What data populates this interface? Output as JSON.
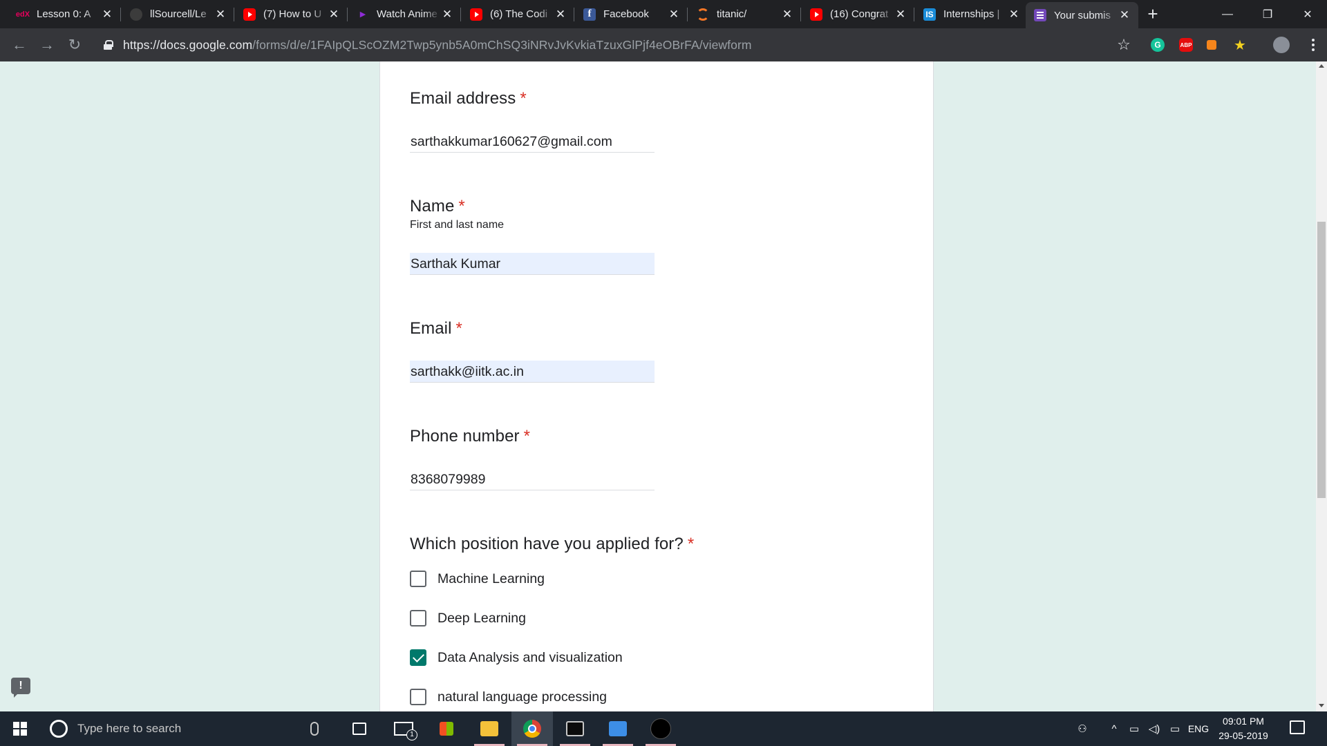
{
  "browser": {
    "tabs": [
      {
        "title": "Lesson 0: A",
        "favicon": "edx-icon",
        "favicon_text": "edX",
        "active": false
      },
      {
        "title": "llSourcell/Le",
        "favicon": "github-icon",
        "favicon_text": "",
        "active": false
      },
      {
        "title": "(7) How to U",
        "favicon": "youtube-icon",
        "favicon_text": "",
        "active": false
      },
      {
        "title": "Watch Anime",
        "favicon": "play-icon",
        "favicon_text": "▶",
        "active": false
      },
      {
        "title": "(6) The Codi",
        "favicon": "youtube-icon",
        "favicon_text": "",
        "active": false
      },
      {
        "title": "Facebook",
        "favicon": "facebook-icon",
        "favicon_text": "f",
        "active": false
      },
      {
        "title": "titanic/",
        "favicon": "kaggle-icon",
        "favicon_text": "",
        "active": false
      },
      {
        "title": "(16) Congrat",
        "favicon": "youtube-icon",
        "favicon_text": "",
        "active": false
      },
      {
        "title": "Internships |",
        "favicon": "internshala-icon",
        "favicon_text": "IS",
        "active": false
      },
      {
        "title": "Your submis",
        "favicon": "google-forms-icon",
        "favicon_text": "",
        "active": true
      }
    ],
    "new_tab_glyph": "+",
    "url_host": "https://docs.google.com",
    "url_path": "/forms/d/e/1FAIpQLScOZM2Twp5ynb5A0mChSQ3iNRvJvKvkiaTzuxGlPjf4eOBrFA/viewform",
    "extensions": [
      {
        "name": "grammarly-icon",
        "label": "G",
        "color": "#15c39a"
      },
      {
        "name": "adblock-plus-icon",
        "label": "ABP",
        "color": "#e40d0d"
      },
      {
        "name": "metamask-icon",
        "label": "",
        "color": "#f6851b"
      },
      {
        "name": "star-extension-icon",
        "label": "",
        "color": "#f4d21f"
      },
      {
        "name": "profile-avatar-icon",
        "label": "",
        "color": "#8a8f98"
      }
    ]
  },
  "form": {
    "questions": [
      {
        "title": "Email address",
        "required_mark": "*",
        "description": "",
        "answer": "sarthakkumar160627@gmail.com"
      },
      {
        "title": "Name",
        "required_mark": "*",
        "description": "First and last name",
        "answer": "Sarthak Kumar"
      },
      {
        "title": "Email",
        "required_mark": "*",
        "description": "",
        "answer": "sarthakk@iitk.ac.in"
      },
      {
        "title": "Phone number",
        "required_mark": "*",
        "description": "",
        "answer": "8368079989"
      }
    ],
    "position_question": {
      "title": "Which position have you applied for?",
      "required_mark": "*",
      "options": [
        {
          "label": "Machine Learning",
          "checked": false
        },
        {
          "label": "Deep Learning",
          "checked": false
        },
        {
          "label": "Data Analysis and visualization",
          "checked": true
        },
        {
          "label": "natural language processing",
          "checked": false
        }
      ]
    },
    "accent_color": "#00796b",
    "required_color": "#d93025",
    "autofill_color": "#e8f0fe",
    "feedback_glyph": "!"
  },
  "taskbar": {
    "search_placeholder": "Type here to search",
    "mail_badge": "1",
    "language": "ENG",
    "time": "09:01 PM",
    "date": "29-05-2019"
  }
}
